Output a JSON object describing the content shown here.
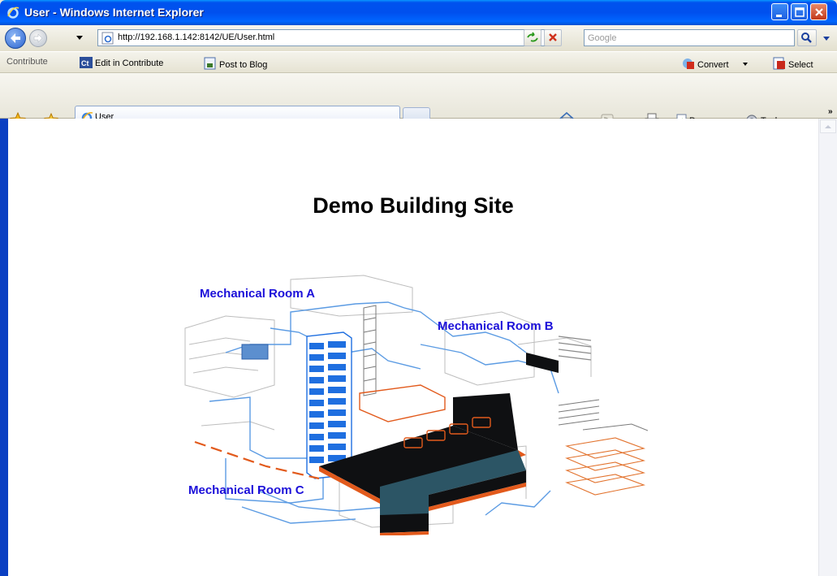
{
  "window": {
    "title": "User - Windows Internet Explorer"
  },
  "address_bar": {
    "url": "http://192.168.1.142:8142/UE/User.html",
    "search_placeholder": "Google"
  },
  "links_bar": {
    "contribute_label": "Contribute",
    "edit_label": "Edit in Contribute",
    "post_label": "Post to Blog",
    "convert_label": "Convert",
    "select_label": "Select"
  },
  "tabs": [
    {
      "label": "User"
    }
  ],
  "command_bar": {
    "page_label": "Page",
    "tools_label": "Tools"
  },
  "page": {
    "title": "Demo Building Site",
    "rooms": [
      {
        "label": "Mechanical Room A"
      },
      {
        "label": "Mechanical Room B"
      },
      {
        "label": "Mechanical Room C"
      }
    ]
  },
  "colors": {
    "title_bar": "#0053EE",
    "room_label": "#1B0FD9",
    "building_blue": "#1F6FE0",
    "building_dark": "#0F1012",
    "building_teal": "#2C5565",
    "duct_orange": "#E25A1C"
  },
  "icons": [
    "ie-logo-icon",
    "minimize-icon",
    "maximize-icon",
    "close-icon",
    "back-arrow-icon",
    "forward-arrow-icon",
    "page-icon",
    "refresh-icon",
    "stop-icon",
    "search-icon",
    "favorites-star-icon",
    "add-favorite-icon",
    "home-icon",
    "feeds-icon",
    "print-icon",
    "page-menu-icon",
    "tools-gear-icon",
    "contribute-icon",
    "blog-icon",
    "convert-icon",
    "select-icon"
  ]
}
